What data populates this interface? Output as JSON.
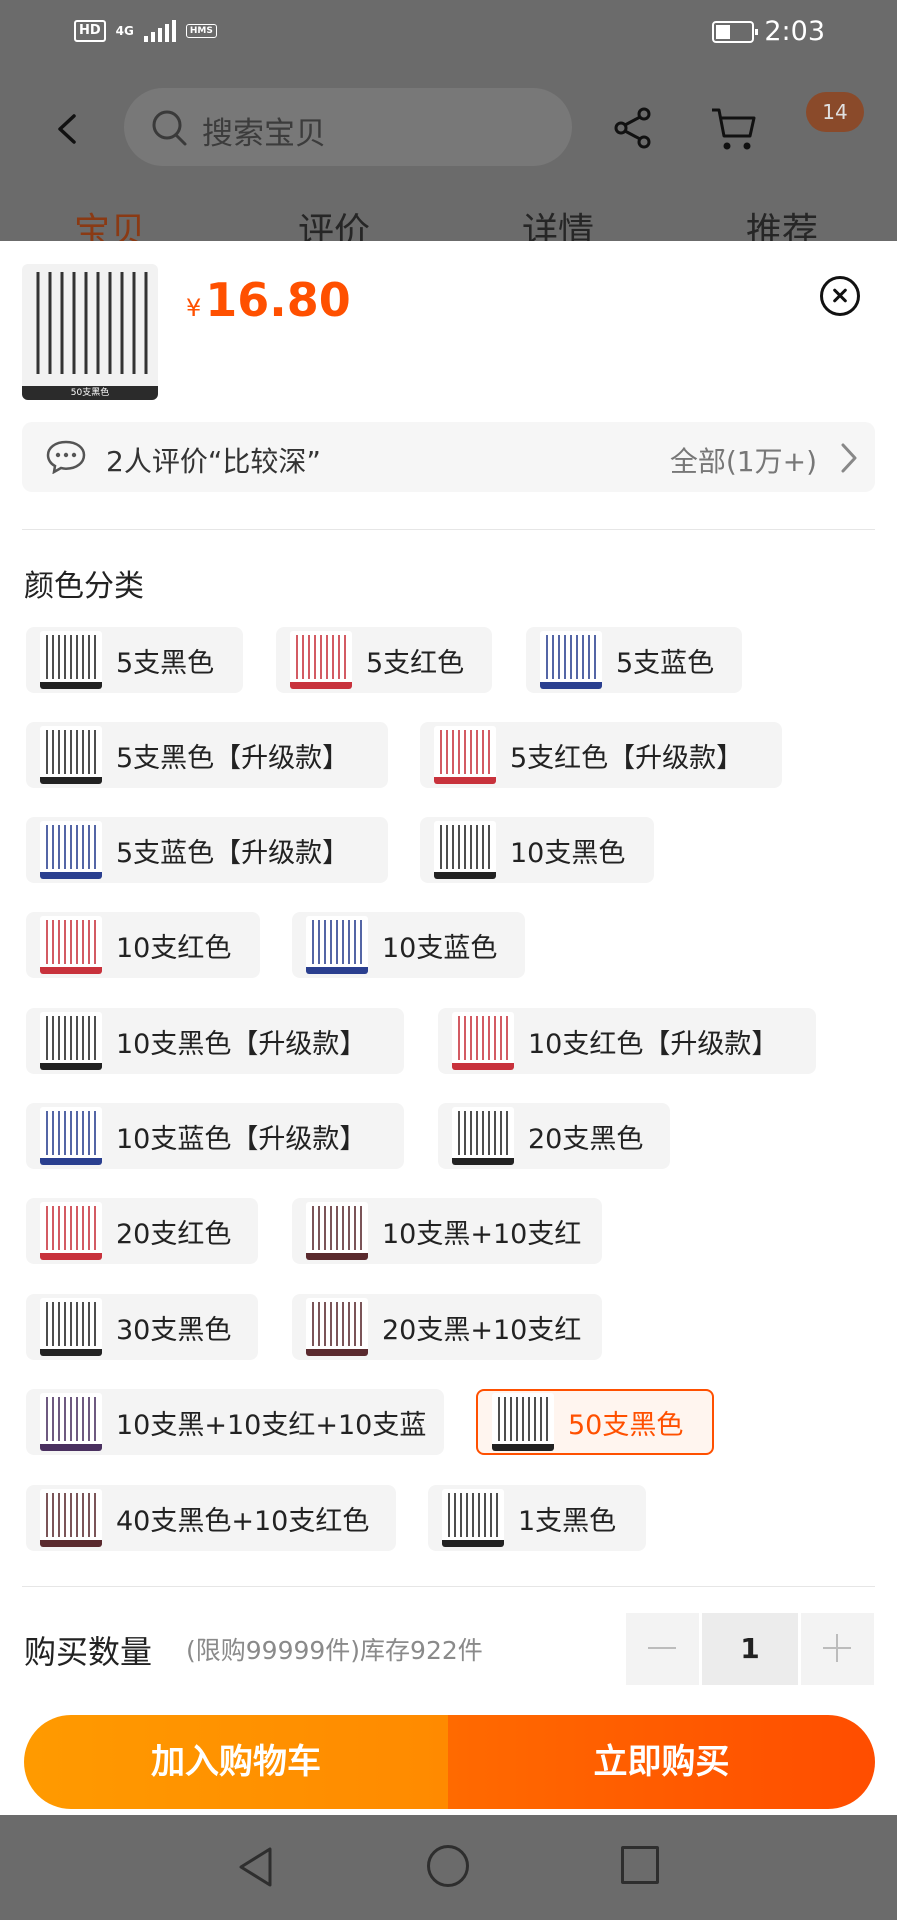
{
  "status_bar": {
    "hd": "HD",
    "network": "4G",
    "hms": "HMS",
    "time": "2:03"
  },
  "header": {
    "search_placeholder": "搜索宝贝",
    "cart_badge": "14",
    "tabs": [
      "宝贝",
      "评价",
      "详情",
      "推荐"
    ],
    "active_tab_color": "#8a3a14"
  },
  "product": {
    "thumb_label": "50支黑色",
    "currency": "¥",
    "price": "16.80",
    "price_color": "#ff5000"
  },
  "review": {
    "text": "2人评价“比较深”",
    "all": "全部(1万+)"
  },
  "variants": {
    "title": "颜色分类",
    "options": [
      {
        "label": "5支黑色",
        "swatch": "#222222"
      },
      {
        "label": "5支红色",
        "swatch": "#c8323c"
      },
      {
        "label": "5支蓝色",
        "swatch": "#2a3f8f"
      },
      {
        "label": "5支黑色【升级款】",
        "swatch": "#222222"
      },
      {
        "label": "5支红色【升级款】",
        "swatch": "#c8323c"
      },
      {
        "label": "5支蓝色【升级款】",
        "swatch": "#2a3f8f"
      },
      {
        "label": "10支黑色",
        "swatch": "#222222"
      },
      {
        "label": "10支红色",
        "swatch": "#c8323c"
      },
      {
        "label": "10支蓝色",
        "swatch": "#2a3f8f"
      },
      {
        "label": "10支黑色【升级款】",
        "swatch": "#222222"
      },
      {
        "label": "10支红色【升级款】",
        "swatch": "#c8323c"
      },
      {
        "label": "10支蓝色【升级款】",
        "swatch": "#2a3f8f"
      },
      {
        "label": "20支黑色",
        "swatch": "#222222"
      },
      {
        "label": "20支红色",
        "swatch": "#c8323c"
      },
      {
        "label": "10支黑+10支红",
        "swatch": "#5a2a2e"
      },
      {
        "label": "30支黑色",
        "swatch": "#222222"
      },
      {
        "label": "20支黑+10支红",
        "swatch": "#5a2a2e"
      },
      {
        "label": "10支黑+10支红+10支蓝",
        "swatch": "#4a3060"
      },
      {
        "label": "50支黑色",
        "swatch": "#222222",
        "selected": true
      },
      {
        "label": "40支黑色+10支红色",
        "swatch": "#5a2a2e"
      },
      {
        "label": "1支黑色",
        "swatch": "#222222"
      }
    ],
    "selected_color": "#ff5000"
  },
  "quantity": {
    "title": "购买数量",
    "note": "(限购99999件)库存922件",
    "value": "1"
  },
  "actions": {
    "add_to_cart": "加入购物车",
    "buy_now": "立即购买"
  }
}
